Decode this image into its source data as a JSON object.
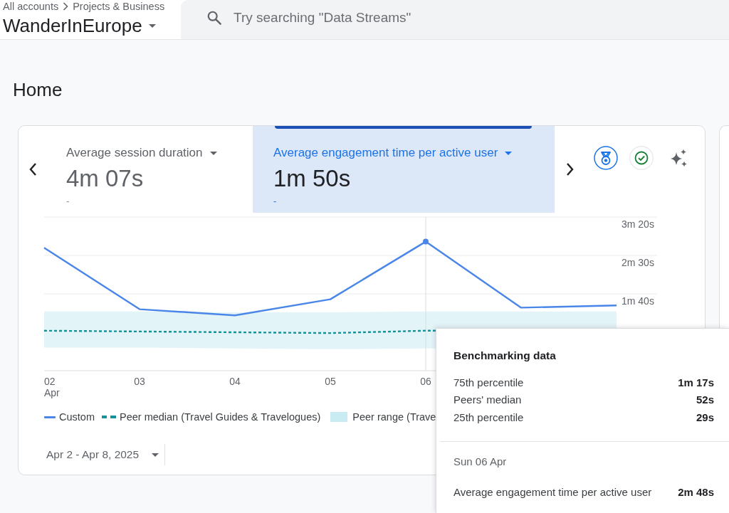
{
  "header": {
    "breadcrumb": [
      "All accounts",
      "Projects & Business"
    ],
    "property": "WanderInEurope",
    "search": {
      "placeholder": "Try searching \"Data Streams\""
    }
  },
  "page": {
    "title": "Home"
  },
  "card": {
    "metrics": [
      {
        "label": "Average session duration",
        "value": "4m 07s",
        "change": "-",
        "selected": false
      },
      {
        "label": "Average engagement time per active user",
        "value": "1m 50s",
        "change": "-",
        "selected": true
      }
    ],
    "chart": {
      "y_axis_labels": [
        "3m 20s",
        "2m 30s",
        "1m 40s"
      ],
      "x_axis_labels": [
        "02\nApr",
        "03",
        "04",
        "05",
        "06"
      ],
      "legend": [
        {
          "label": "Custom",
          "kind": "line",
          "color": "#4a86e8"
        },
        {
          "label": "Peer median (Travel Guides & Travelogues)",
          "kind": "dashed",
          "color": "#12939a"
        },
        {
          "label": "Peer range (Trave",
          "kind": "band",
          "color": "#c8ecf2"
        }
      ]
    },
    "date_range": "Apr 2 - Apr 8, 2025"
  },
  "tooltip": {
    "title": "Benchmarking data",
    "rows": [
      {
        "label": "75th percentile",
        "value": "1m 17s"
      },
      {
        "label": "Peers' median",
        "value": "52s"
      },
      {
        "label": "25th percentile",
        "value": "29s"
      }
    ],
    "date": "Sun 06 Apr",
    "metric": {
      "label": "Average engagement time per active user",
      "value": "2m 48s"
    }
  }
}
